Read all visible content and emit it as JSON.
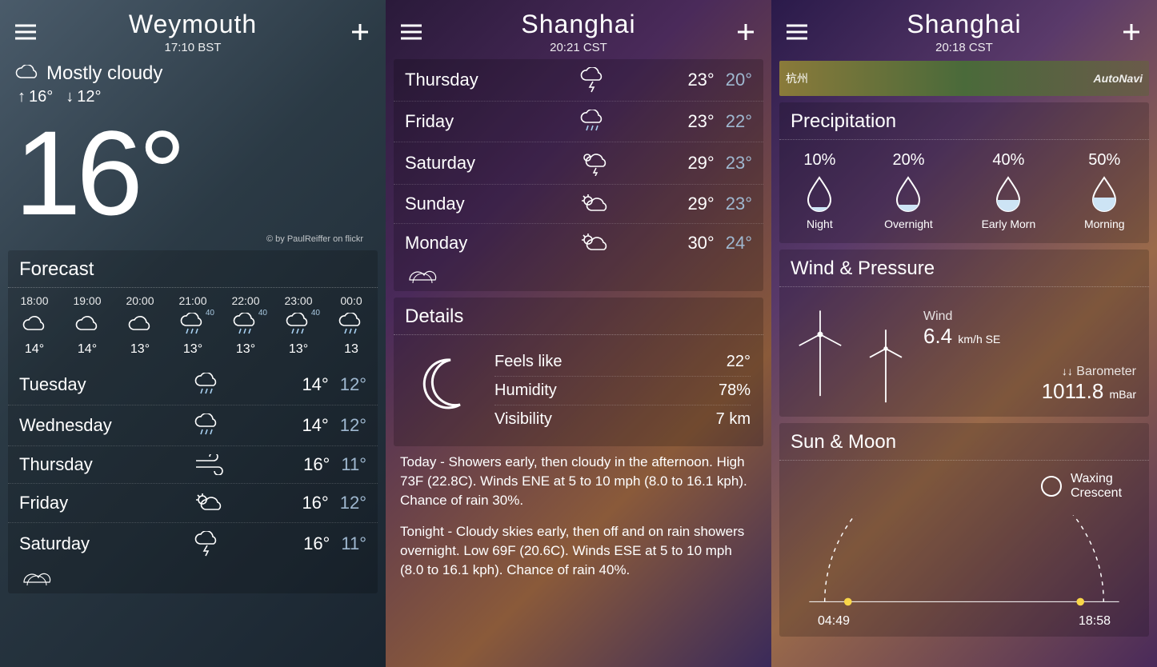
{
  "screen1": {
    "city": "Weymouth",
    "time": "17:10 BST",
    "condition": "Mostly cloudy",
    "hi": "16°",
    "lo": "12°",
    "current": "16°",
    "credit": "© by PaulReiffer on flickr",
    "forecast_label": "Forecast",
    "hourly": [
      {
        "t": "18:00",
        "temp": "14°",
        "icon": "cloud",
        "pop": ""
      },
      {
        "t": "19:00",
        "temp": "14°",
        "icon": "cloud",
        "pop": ""
      },
      {
        "t": "20:00",
        "temp": "13°",
        "icon": "cloud",
        "pop": ""
      },
      {
        "t": "21:00",
        "temp": "13°",
        "icon": "rain",
        "pop": "40"
      },
      {
        "t": "22:00",
        "temp": "13°",
        "icon": "rain",
        "pop": "40"
      },
      {
        "t": "23:00",
        "temp": "13°",
        "icon": "rain",
        "pop": "40"
      },
      {
        "t": "00:0",
        "temp": "13",
        "icon": "rain",
        "pop": ""
      }
    ],
    "daily": [
      {
        "d": "Tuesday",
        "icon": "rain",
        "hi": "14°",
        "lo": "12°"
      },
      {
        "d": "Wednesday",
        "icon": "rain",
        "hi": "14°",
        "lo": "12°"
      },
      {
        "d": "Thursday",
        "icon": "wind",
        "hi": "16°",
        "lo": "11°"
      },
      {
        "d": "Friday",
        "icon": "partly",
        "hi": "16°",
        "lo": "12°"
      },
      {
        "d": "Saturday",
        "icon": "thunder",
        "hi": "16°",
        "lo": "11°"
      }
    ]
  },
  "screen2": {
    "city": "Shanghai",
    "time": "20:21 CST",
    "daily": [
      {
        "d": "Thursday",
        "icon": "thunder",
        "hi": "23°",
        "lo": "20°"
      },
      {
        "d": "Friday",
        "icon": "rain",
        "hi": "23°",
        "lo": "22°"
      },
      {
        "d": "Saturday",
        "icon": "sun-thunder",
        "hi": "29°",
        "lo": "23°"
      },
      {
        "d": "Sunday",
        "icon": "partly",
        "hi": "29°",
        "lo": "23°"
      },
      {
        "d": "Monday",
        "icon": "partly",
        "hi": "30°",
        "lo": "24°"
      }
    ],
    "details_label": "Details",
    "feels_like_label": "Feels like",
    "feels_like": "22°",
    "humidity_label": "Humidity",
    "humidity": "78%",
    "visibility_label": "Visibility",
    "visibility": "7 km",
    "today_text": "Today - Showers early, then cloudy in the afternoon. High 73F (22.8C). Winds ENE at 5 to 10 mph (8.0 to 16.1 kph). Chance of rain 30%.",
    "tonight_text": "Tonight - Cloudy skies early, then off and on rain showers overnight. Low 69F (20.6C). Winds ESE at 5 to 10 mph (8.0 to 16.1 kph). Chance of rain 40%."
  },
  "screen3": {
    "city": "Shanghai",
    "time": "20:18 CST",
    "map_left": "杭州",
    "map_right": "AutoNavi",
    "precip_label": "Precipitation",
    "precip": [
      {
        "pct": "10%",
        "lbl": "Night",
        "fill": 10
      },
      {
        "pct": "20%",
        "lbl": "Overnight",
        "fill": 20
      },
      {
        "pct": "40%",
        "lbl": "Early Morn",
        "fill": 40
      },
      {
        "pct": "50%",
        "lbl": "Morning",
        "fill": 50
      }
    ],
    "wind_label": "Wind & Pressure",
    "wind_sub": "Wind",
    "wind_val": "6.4",
    "wind_unit": "km/h SE",
    "baro_label": "Barometer",
    "baro_arrows": "↓↓",
    "baro_val": "1011.8",
    "baro_unit": "mBar",
    "sun_label": "Sun & Moon",
    "moon_phase": "Waxing Crescent",
    "sunrise": "04:49",
    "sunset": "18:58"
  }
}
